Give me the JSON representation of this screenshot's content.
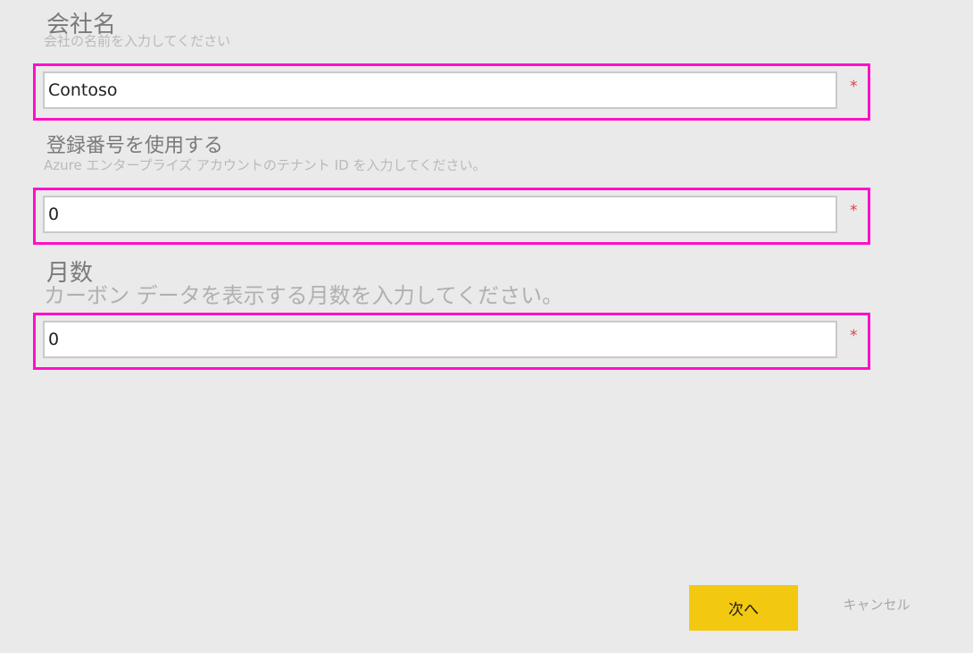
{
  "fields": [
    {
      "title": "会社名",
      "description": "会社の名前を入力してください",
      "value": "Contoso",
      "required_mark": "*"
    },
    {
      "title": "登録番号を使用する",
      "description": "Azure エンタープライズ アカウントのテナント ID を入力してください。",
      "value": "0",
      "required_mark": "*"
    },
    {
      "title": "月数",
      "description": "カーボン データを表示する月数を入力してください。",
      "value": "0",
      "required_mark": "*"
    }
  ],
  "buttons": {
    "next_label": "次へ",
    "cancel_label": "キャンセル"
  },
  "colors": {
    "background": "#eaeaea",
    "highlight": "#ff10c8",
    "primary_button": "#f2c811",
    "required": "#e04040"
  }
}
